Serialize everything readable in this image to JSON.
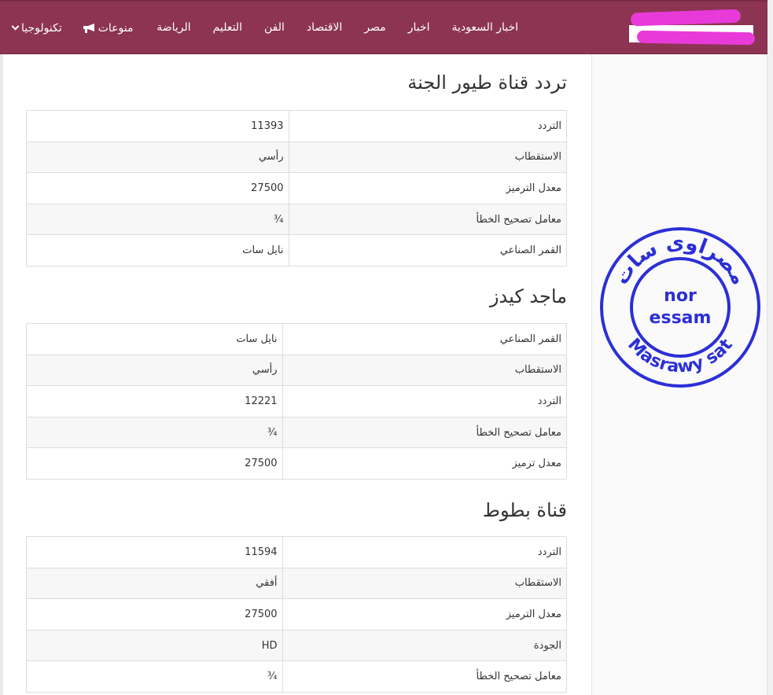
{
  "nav": {
    "links": [
      "اخبار السعودية",
      "اخبار",
      "مصر",
      "الاقتصاد",
      "الفن",
      "التعليم",
      "الرياضة"
    ],
    "dropdown_tech": "تكنولوجيا",
    "dropdown_misc": "منوعات"
  },
  "sections": [
    {
      "title": "تردد قناة طيور الجنة",
      "rows": [
        {
          "key": "التردد",
          "value": "11393"
        },
        {
          "key": "الاستقطاب",
          "value": "رأسي"
        },
        {
          "key": "معدل الترميز",
          "value": "27500"
        },
        {
          "key": "معامل تصحيح الخطأ",
          "value": "¾"
        },
        {
          "key": "القمر الصناعي",
          "value": "نايل سات"
        }
      ]
    },
    {
      "title": "ماجد كيدز",
      "rows": [
        {
          "key": "القمر الصناعي",
          "value": "نايل سات"
        },
        {
          "key": "الاستقطاب",
          "value": "رأسي"
        },
        {
          "key": "التردد",
          "value": "12221"
        },
        {
          "key": "معامل تصحيح الخطأ",
          "value": "¾"
        },
        {
          "key": "معدل ترميز",
          "value": "27500"
        }
      ]
    },
    {
      "title": "قناة بطوط",
      "rows": [
        {
          "key": "التردد",
          "value": "11594"
        },
        {
          "key": "الاستقطاب",
          "value": "أفقي"
        },
        {
          "key": "معدل الترميز",
          "value": "27500"
        },
        {
          "key": "الجودة",
          "value": "HD"
        },
        {
          "key": "معامل تصحيح الخطأ",
          "value": "¾"
        }
      ]
    }
  ],
  "stamp": {
    "arc_arabic": "مصراوى سات",
    "center_line_1": "nor",
    "center_line_2": "essam",
    "arc_english": "Masrawy sat",
    "color": "#2b2fd6"
  },
  "colors": {
    "navbar": "#8c3452",
    "logo_scribble": "#e83ad8"
  }
}
